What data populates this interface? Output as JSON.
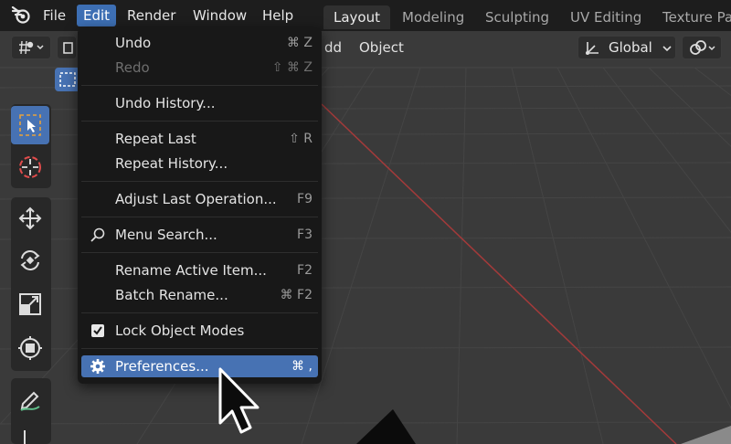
{
  "top_menu": {
    "file": "File",
    "edit": "Edit",
    "render": "Render",
    "window": "Window",
    "help": "Help"
  },
  "workspace_tabs": [
    "Layout",
    "Modeling",
    "Sculpting",
    "UV Editing",
    "Texture Pa"
  ],
  "viewport_header": {
    "add_partial": "dd",
    "object": "Object",
    "transform_orientation": "Global"
  },
  "edit_menu": {
    "undo": {
      "label": "Undo",
      "shortcut": "⌘ Z"
    },
    "redo": {
      "label": "Redo",
      "shortcut": "⇧ ⌘ Z"
    },
    "undo_history": {
      "label": "Undo History..."
    },
    "repeat_last": {
      "label": "Repeat Last",
      "shortcut": "⇧ R"
    },
    "repeat_history": {
      "label": "Repeat History..."
    },
    "adjust_last": {
      "label": "Adjust Last Operation...",
      "shortcut": "F9"
    },
    "menu_search": {
      "label": "Menu Search...",
      "shortcut": "F3"
    },
    "rename_active": {
      "label": "Rename Active Item...",
      "shortcut": "F2"
    },
    "batch_rename": {
      "label": "Batch Rename...",
      "shortcut": "⌘ F2"
    },
    "lock_object_modes": {
      "label": "Lock Object Modes",
      "checked": true
    },
    "preferences": {
      "label": "Preferences...",
      "shortcut": "⌘ ,"
    }
  },
  "colors": {
    "accent": "#4772b3",
    "menu_bg": "#181818",
    "topbar_bg": "#1d1d1d",
    "x_axis": "#a33a3a"
  }
}
